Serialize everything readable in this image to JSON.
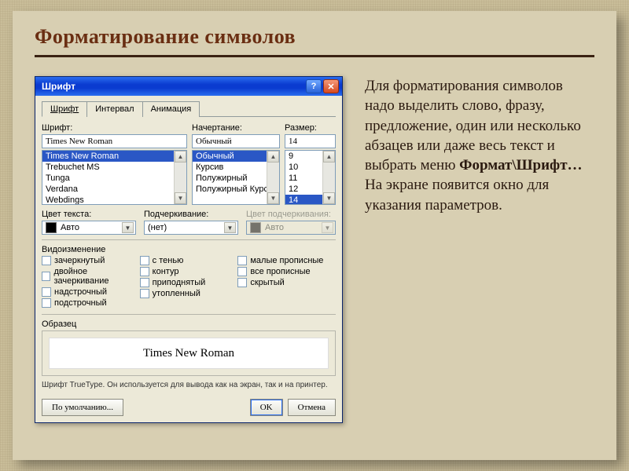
{
  "slide": {
    "title": "Форматирование символов",
    "body_prefix": "Для форматирования символов надо выделить слово, фразу, предложение, один или несколько абзацев или даже весь текст и выбрать меню ",
    "body_bold": "Формат\\Шрифт…",
    "body_suffix": " На экране появится окно для указания параметров."
  },
  "dialog": {
    "title": "Шрифт",
    "tabs": {
      "font": "Шрифт",
      "spacing": "Интервал",
      "anim": "Анимация"
    },
    "labels": {
      "font": "Шрифт:",
      "style": "Начертание:",
      "size": "Размер:",
      "text_color": "Цвет текста:",
      "underline": "Подчеркивание:",
      "underline_color": "Цвет подчеркивания:",
      "effects_section": "Видоизменение",
      "sample_section": "Образец"
    },
    "font": {
      "value": "Times New Roman",
      "options": [
        "Times New Roman",
        "Trebuchet MS",
        "Tunga",
        "Verdana",
        "Webdings"
      ],
      "selected_index": 0
    },
    "style": {
      "value": "Обычный",
      "options": [
        "Обычный",
        "Курсив",
        "Полужирный",
        "Полужирный Курсив"
      ],
      "selected_index": 0
    },
    "size": {
      "value": "14",
      "options": [
        "9",
        "10",
        "11",
        "12",
        "14"
      ],
      "selected_index": 4
    },
    "text_color": {
      "label": "Авто"
    },
    "underline": {
      "value": "(нет)"
    },
    "underline_color": {
      "label": "Авто"
    },
    "effects": {
      "col1": [
        "зачеркнутый",
        "двойное зачеркивание",
        "надстрочный",
        "подстрочный"
      ],
      "col2": [
        "с тенью",
        "контур",
        "приподнятый",
        "утопленный"
      ],
      "col3": [
        "малые прописные",
        "все прописные",
        "скрытый"
      ]
    },
    "sample_text": "Times New Roman",
    "hint": "Шрифт TrueType. Он используется для вывода как на экран, так и на принтер.",
    "buttons": {
      "default": "По умолчанию...",
      "ok": "OK",
      "cancel": "Отмена"
    }
  }
}
